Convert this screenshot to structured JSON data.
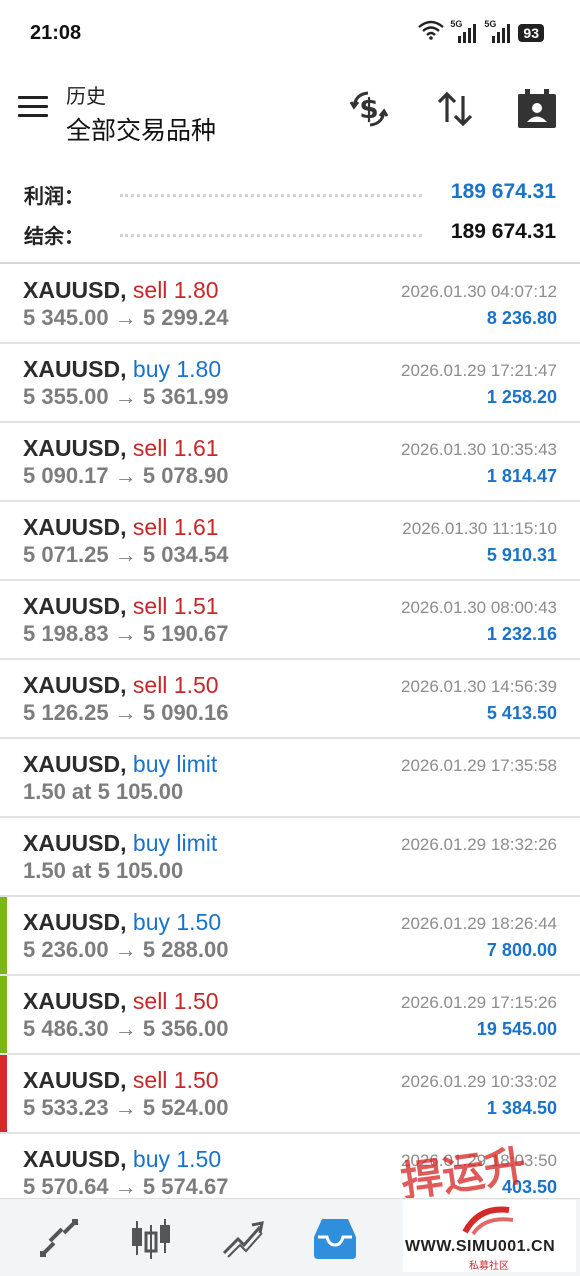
{
  "status_bar": {
    "time": "21:08",
    "signal_1_label": "5G",
    "signal_2_label": "5G",
    "battery": "93",
    "icons": [
      "wifi-icon",
      "signal-icon",
      "signal-icon",
      "battery-icon"
    ]
  },
  "header": {
    "subtitle": "历史",
    "title": "全部交易品种",
    "actions": [
      "dollar-swap-icon",
      "sort-icon",
      "calendar-icon"
    ]
  },
  "summary": {
    "profit_label": "利润：",
    "profit_value": "189 674.31",
    "balance_label": "结余：",
    "balance_value": "189 674.31",
    "colors": {
      "profit": "#1a73c9",
      "balance": "#111111"
    }
  },
  "trades": [
    {
      "symbol": "XAUUSD,",
      "side": "sell 1.80",
      "side_type": "sell",
      "prices": "5 345.00 → 5 299.24",
      "time": "2026.01.30 04:07:12",
      "profit": "8 236.80",
      "marker": ""
    },
    {
      "symbol": "XAUUSD,",
      "side": "buy 1.80",
      "side_type": "buy",
      "prices": "5 355.00 → 5 361.99",
      "time": "2026.01.29 17:21:47",
      "profit": "1 258.20",
      "marker": ""
    },
    {
      "symbol": "XAUUSD,",
      "side": "sell 1.61",
      "side_type": "sell",
      "prices": "5 090.17 → 5 078.90",
      "time": "2026.01.30 10:35:43",
      "profit": "1 814.47",
      "marker": ""
    },
    {
      "symbol": "XAUUSD,",
      "side": "sell 1.61",
      "side_type": "sell",
      "prices": "5 071.25 → 5 034.54",
      "time": "2026.01.30 11:15:10",
      "profit": "5 910.31",
      "marker": ""
    },
    {
      "symbol": "XAUUSD,",
      "side": "sell 1.51",
      "side_type": "sell",
      "prices": "5 198.83 → 5 190.67",
      "time": "2026.01.30 08:00:43",
      "profit": "1 232.16",
      "marker": ""
    },
    {
      "symbol": "XAUUSD,",
      "side": "sell 1.50",
      "side_type": "sell",
      "prices": "5 126.25 → 5 090.16",
      "time": "2026.01.30 14:56:39",
      "profit": "5 413.50",
      "marker": ""
    },
    {
      "symbol": "XAUUSD,",
      "side": "buy limit",
      "side_type": "buy",
      "prices": "1.50 at 5 105.00",
      "time": "2026.01.29 17:35:58",
      "profit": "",
      "marker": ""
    },
    {
      "symbol": "XAUUSD,",
      "side": "buy limit",
      "side_type": "buy",
      "prices": "1.50 at 5 105.00",
      "time": "2026.01.29 18:32:26",
      "profit": "",
      "marker": ""
    },
    {
      "symbol": "XAUUSD,",
      "side": "buy 1.50",
      "side_type": "buy",
      "prices": "5 236.00 → 5 288.00",
      "time": "2026.01.29 18:26:44",
      "profit": "7 800.00",
      "marker": "#7cb518"
    },
    {
      "symbol": "XAUUSD,",
      "side": "sell 1.50",
      "side_type": "sell",
      "prices": "5 486.30 → 5 356.00",
      "time": "2026.01.29 17:15:26",
      "profit": "19 545.00",
      "marker": "#7cb518"
    },
    {
      "symbol": "XAUUSD,",
      "side": "sell 1.50",
      "side_type": "sell",
      "prices": "5 533.23 → 5 524.00",
      "time": "2026.01.29 10:33:02",
      "profit": "1 384.50",
      "marker": "#d42a2a"
    },
    {
      "symbol": "XAUUSD,",
      "side": "buy 1.50",
      "side_type": "buy",
      "prices": "5 570.64 → 5 574.67",
      "time": "2026.01.29 18:03:50",
      "profit": "403.50",
      "marker": ""
    }
  ],
  "side_colors": {
    "sell": "#c62828",
    "buy": "#1a73c9"
  },
  "bottom_nav": {
    "items": [
      "quotes-icon",
      "chart-icon",
      "trade-icon",
      "history-icon"
    ],
    "active_index": 3,
    "active_color": "#2f8fdd"
  },
  "watermark": {
    "stamp": "捍运升",
    "site": "WWW.SIMU001.CN",
    "sub": "私募社区"
  }
}
